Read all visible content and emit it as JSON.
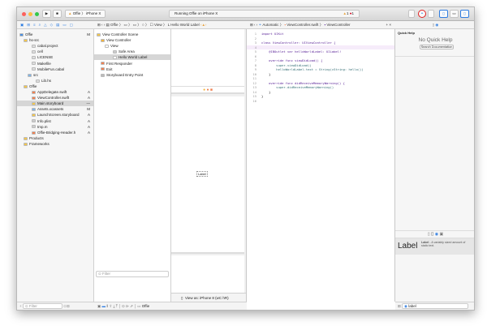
{
  "toolbar": {
    "scheme": "Offie",
    "device": "iPhone X",
    "status": "Running Offie on iPhone X",
    "warnings": "1",
    "errors": "1"
  },
  "jump_bar_ib": [
    "Offie",
    "View",
    "Hello World Label"
  ],
  "jump_bar_code": [
    "Automatic",
    "ViewController.swift",
    "ViewController"
  ],
  "navigator": {
    "items": [
      {
        "label": "Offie",
        "status": "M",
        "indent": 0,
        "color": "#4a90e2"
      },
      {
        "label": "hs-src",
        "status": "",
        "indent": 1,
        "color": "#f3c64d"
      },
      {
        "label": "cabal.project",
        "status": "",
        "indent": 3,
        "color": "#ddd"
      },
      {
        "label": "cell",
        "status": "",
        "indent": 3,
        "color": "#ddd"
      },
      {
        "label": "LICENSE",
        "status": "",
        "indent": 3,
        "color": "#ddd"
      },
      {
        "label": "Makefile",
        "status": "",
        "indent": 3,
        "color": "#ddd"
      },
      {
        "label": "MobileFun.cabal",
        "status": "",
        "indent": 3,
        "color": "#ddd"
      },
      {
        "label": "src",
        "status": "",
        "indent": 2,
        "color": "#7fb3e6"
      },
      {
        "label": "Lib.hs",
        "status": "",
        "indent": 4,
        "color": "#ddd"
      },
      {
        "label": "Offie",
        "status": "",
        "indent": 1,
        "color": "#f3c64d"
      },
      {
        "label": "AppDelegate.swift",
        "status": "A",
        "indent": 3,
        "color": "#f08050"
      },
      {
        "label": "ViewController.swift",
        "status": "A",
        "indent": 3,
        "color": "#f08050"
      },
      {
        "label": "Main.storyboard",
        "status": "—",
        "indent": 3,
        "color": "#f3c64d"
      },
      {
        "label": "Assets.xcassets",
        "status": "M",
        "indent": 3,
        "color": "#7fb3e6"
      },
      {
        "label": "LaunchScreen.storyboard",
        "status": "A",
        "indent": 3,
        "color": "#f3c64d"
      },
      {
        "label": "Info.plist",
        "status": "A",
        "indent": 3,
        "color": "#ccc"
      },
      {
        "label": "tmp.m",
        "status": "A",
        "indent": 3,
        "color": "#ccc"
      },
      {
        "label": "Offie-Bridging-Header.h",
        "status": "A",
        "indent": 3,
        "color": "#f08050"
      },
      {
        "label": "Products",
        "status": "",
        "indent": 1,
        "color": "#f3c64d"
      },
      {
        "label": "Frameworks",
        "status": "",
        "indent": 1,
        "color": "#f3c64d"
      }
    ],
    "filter_placeholder": "Filter"
  },
  "outline": {
    "items": [
      {
        "label": "View Controller Scene",
        "indent": 0,
        "color": "#f3c64d"
      },
      {
        "label": "View Controller",
        "indent": 1,
        "color": "#f3b43d"
      },
      {
        "label": "View",
        "indent": 2,
        "color": "#fff"
      },
      {
        "label": "Safe Area",
        "indent": 4,
        "color": "#ccc"
      },
      {
        "label": "Hello World Label",
        "indent": 4,
        "color": "#fff"
      },
      {
        "label": "First Responder",
        "indent": 1,
        "color": "#f08050"
      },
      {
        "label": "Exit",
        "indent": 1,
        "color": "#f08050"
      },
      {
        "label": "Storyboard Entry Point",
        "indent": 1,
        "color": "#bbb"
      }
    ],
    "filter_placeholder": "Filter"
  },
  "canvas": {
    "label_text": "Label",
    "view_as": "View as: iPhone 8 (wC hR)",
    "bottom_name": "Offie"
  },
  "code_lines": [
    "import UIKit",
    "",
    "class ViewController: UIViewController {",
    "",
    "    @IBOutlet var helloWorldLabel: UILabel!",
    "",
    "    override func viewDidLoad() {",
    "        super.viewDidLoad()",
    "        helloWorldLabel.text = String(cString: hello())",
    "    }",
    "",
    "    override func didReceiveMemoryWarning() {",
    "        super.didReceiveMemoryWarning()",
    "    }",
    "}",
    ""
  ],
  "utilities": {
    "quick_help_title": "Quick Help",
    "no_help": "No Quick Help",
    "search_button": "Search Documentation",
    "library_item_title": "Label",
    "library_item_name": "Label",
    "library_item_desc": "- A variably sized amount of static text.",
    "library_filter": "label"
  }
}
